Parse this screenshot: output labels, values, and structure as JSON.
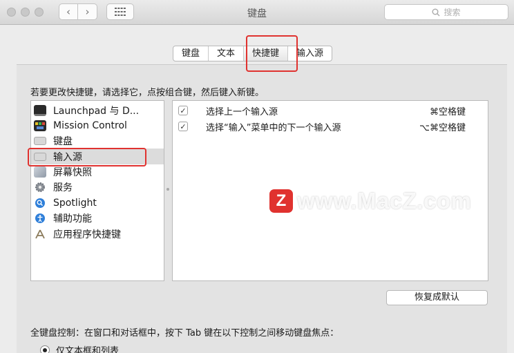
{
  "window": {
    "title": "键盘",
    "search_placeholder": "搜索"
  },
  "tabs": [
    {
      "label": "键盘"
    },
    {
      "label": "文本"
    },
    {
      "label": "快捷键"
    },
    {
      "label": "输入源"
    }
  ],
  "instruction": "若要更改快捷键，请选择它，点按组合键，然后键入新键。",
  "categories": [
    {
      "label": "Launchpad 与 D...",
      "icon": "launchpad-dock-icon"
    },
    {
      "label": "Mission Control",
      "icon": "mission-control-icon"
    },
    {
      "label": "键盘",
      "icon": "keyboard-icon"
    },
    {
      "label": "输入源",
      "icon": "input-source-icon"
    },
    {
      "label": "屏幕快照",
      "icon": "screenshot-icon"
    },
    {
      "label": "服务",
      "icon": "services-gear-icon"
    },
    {
      "label": "Spotlight",
      "icon": "spotlight-icon"
    },
    {
      "label": "辅助功能",
      "icon": "accessibility-icon"
    },
    {
      "label": "应用程序快捷键",
      "icon": "app-shortcuts-icon"
    }
  ],
  "shortcuts": [
    {
      "checked": true,
      "label": "选择上一个输入源",
      "key": "⌘空格键"
    },
    {
      "checked": true,
      "label": "选择“输入”菜单中的下一个输入源",
      "key": "⌥⌘空格键"
    }
  ],
  "restore_label": "恢复成默认",
  "keyboard_control_label": "全键盘控制：在窗口和对话框中，按下 Tab 键在以下控制之间移动键盘焦点：",
  "radio_option": "仅文本框和列表",
  "watermark": {
    "logo": "Z",
    "text": "www.MacZ.com"
  },
  "colors": {
    "highlight_box": "#e0322f",
    "selected_row": "#dcdcdc"
  }
}
